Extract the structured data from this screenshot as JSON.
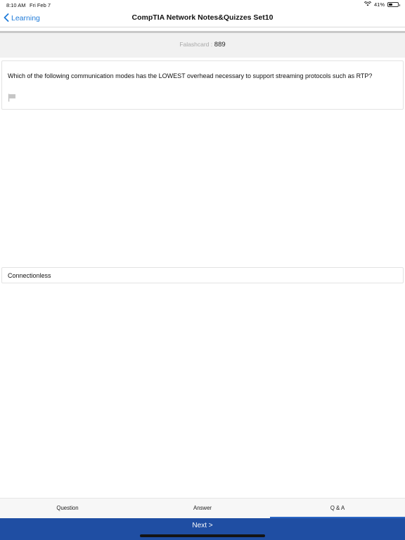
{
  "status_bar": {
    "time": "8:10 AM",
    "date": "Fri Feb 7",
    "battery": "41%",
    "battery_level": 0.41,
    "icons": [
      "wifi-icon",
      "battery-icon"
    ]
  },
  "nav": {
    "back_label": "Learning",
    "title": "CompTIA Network Notes&Quizzes Set10",
    "accent_color": "#1f7bd9"
  },
  "counter": {
    "label": "Falashcard :",
    "value": "889"
  },
  "question": {
    "text": "Which of the following communication modes has the LOWEST overhead necessary to support streaming protocols such as RTP?",
    "flag_icon": "flag-icon"
  },
  "answer": {
    "text": "Connectionless"
  },
  "tabs": [
    {
      "label": "Question",
      "active": false
    },
    {
      "label": "Answer",
      "active": false
    },
    {
      "label": "Q & A",
      "active": true
    }
  ],
  "next": {
    "label": "Next >",
    "bar_color": "#1f4ea3"
  }
}
